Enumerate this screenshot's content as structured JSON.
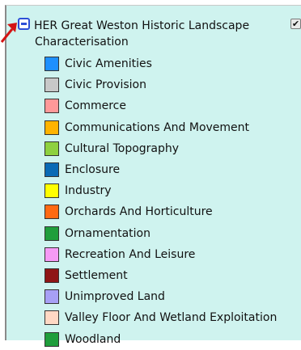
{
  "layer": {
    "title_line1": "HER Great Weston Historic Landscape",
    "title_line2": "Characterisation",
    "visible_check": "✔"
  },
  "legend": [
    {
      "label": "Civic Amenities",
      "color": "#1e90ff"
    },
    {
      "label": "Civic Provision",
      "color": "#c8c8c8"
    },
    {
      "label": "Commerce",
      "color": "#ff9999"
    },
    {
      "label": "Communications And Movement",
      "color": "#ffb300"
    },
    {
      "label": "Cultural Topography",
      "color": "#8ed13f"
    },
    {
      "label": "Enclosure",
      "color": "#0a6ab5"
    },
    {
      "label": "Industry",
      "color": "#ffff00"
    },
    {
      "label": "Orchards And Horticulture",
      "color": "#ff6a13"
    },
    {
      "label": "Ornamentation",
      "color": "#1f9e3c"
    },
    {
      "label": "Recreation And Leisure",
      "color": "#f59af5"
    },
    {
      "label": "Settlement",
      "color": "#8f1616"
    },
    {
      "label": "Unimproved Land",
      "color": "#a7a0f5"
    },
    {
      "label": "Valley Floor And Wetland Exploitation",
      "color": "#ffd8c4"
    },
    {
      "label": "Woodland",
      "color": "#1f9e3c"
    }
  ],
  "icons": {
    "collapse": "minus-box-icon",
    "pointer": "red-arrow-icon",
    "visibility": "checkbox-icon"
  },
  "accent_colors": {
    "panel_bg": "#cff3ef",
    "collapse_border": "#2d4fd6",
    "arrow": "#d41414"
  }
}
